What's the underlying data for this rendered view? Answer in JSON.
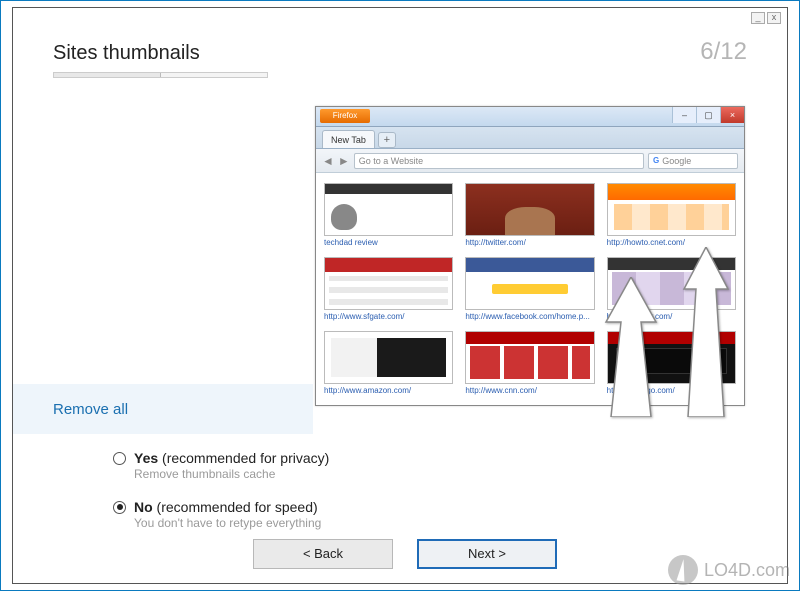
{
  "header": {
    "title": "Sites thumbnails",
    "step_label": "6/12"
  },
  "question": {
    "label": "Remove all"
  },
  "options": {
    "yes": {
      "label": "Yes",
      "detail": " (recommended for privacy)",
      "sub": "Remove thumbnails cache",
      "selected": false
    },
    "no": {
      "label": "No",
      "detail": " (recommended for speed)",
      "sub": "You don't have to retype everything",
      "selected": true
    }
  },
  "nav": {
    "back": "< Back",
    "next": "Next >"
  },
  "illustration": {
    "menu_button": "Firefox",
    "tab_label": "New Tab",
    "url_placeholder": "Go to a Website",
    "search_placeholder": "Google",
    "thumbs": [
      {
        "label": "techdad review"
      },
      {
        "label": "http://twitter.com/"
      },
      {
        "label": "http://howto.cnet.com/"
      },
      {
        "label": "http://www.sfgate.com/"
      },
      {
        "label": "http://www.facebook.com/home.p..."
      },
      {
        "label": "http://xfinitytv.com/"
      },
      {
        "label": "http://www.amazon.com/"
      },
      {
        "label": "http://www.cnn.com/"
      },
      {
        "label": "http://espn.go.com/"
      }
    ]
  },
  "watermark": "LO4D.com"
}
